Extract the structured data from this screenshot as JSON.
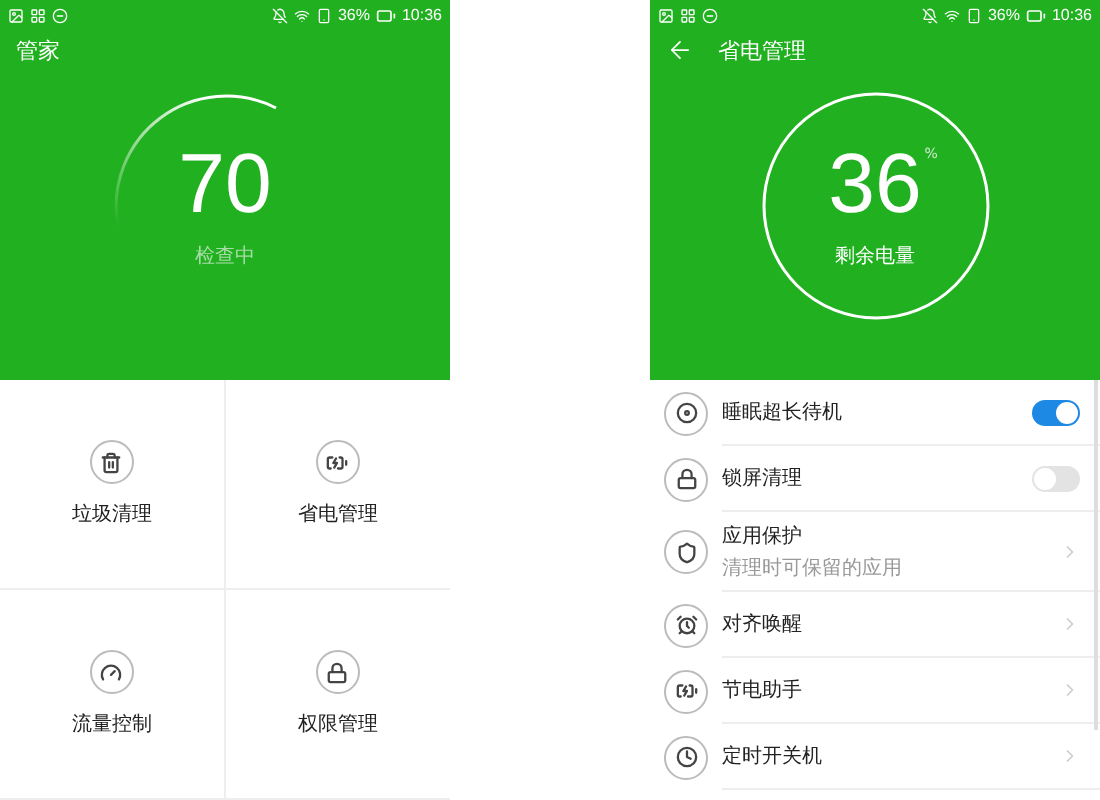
{
  "home": {
    "status_bar": {
      "battery": "36%",
      "time": "10:36"
    },
    "title": "管家",
    "score": {
      "value": "70",
      "caption": "检查中"
    },
    "tiles": [
      {
        "label": "垃圾清理"
      },
      {
        "label": "省电管理"
      },
      {
        "label": "流量控制"
      },
      {
        "label": "权限管理"
      }
    ]
  },
  "power": {
    "status_bar": {
      "battery": "36%",
      "time": "10:36"
    },
    "title": "省电管理",
    "battery": {
      "value": "36",
      "unit": "%",
      "caption": "剩余电量"
    },
    "rows": [
      {
        "kind": "toggle",
        "label": "睡眠超长待机",
        "on": true
      },
      {
        "kind": "toggle",
        "label": "锁屏清理",
        "on": false
      },
      {
        "kind": "link",
        "label": "应用保护",
        "subtitle": "清理时可保留的应用"
      },
      {
        "kind": "link",
        "label": "对齐唤醒"
      },
      {
        "kind": "link",
        "label": "节电助手"
      },
      {
        "kind": "link",
        "label": "定时开关机"
      }
    ]
  }
}
